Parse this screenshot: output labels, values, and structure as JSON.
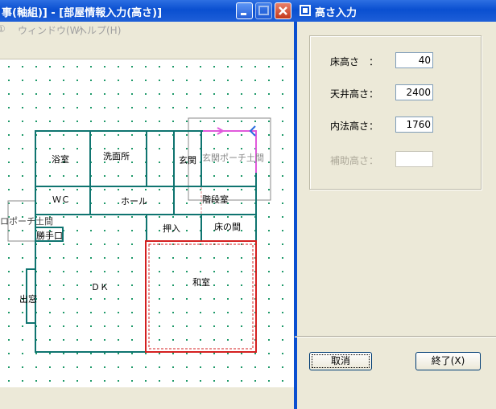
{
  "bg_window": {
    "title": "事(軸組)] - [部屋情報入力(高さ)]",
    "menu": [
      "①",
      "ウィンドウ(W)",
      "ヘルプ(H)"
    ]
  },
  "floor_plan": {
    "rooms": {
      "bath": "浴室",
      "washroom": "洗面所",
      "entrance": "玄関",
      "porch": "玄関ポーチ土間",
      "wc": "ＷＣ",
      "hall": "ホール",
      "stairs": "階段室",
      "back_porch": "ロポーチ土間",
      "back_door": "勝手口",
      "closet": "押入",
      "tokonoma": "床の間",
      "dk": "ＤＫ",
      "washitsu": "和室",
      "bay": "出窓"
    },
    "colors": {
      "wall": "#0f7470",
      "selected": "#d42020",
      "dot": "#1f9a6a"
    }
  },
  "dialog": {
    "title": "高さ入力",
    "fields": [
      {
        "label": "床高さ　：",
        "value": "40",
        "enabled": true
      },
      {
        "label": "天井高さ：",
        "value": "2400",
        "enabled": true
      },
      {
        "label": "内法高さ：",
        "value": "1760",
        "enabled": true
      },
      {
        "label": "補助高さ：",
        "value": "",
        "enabled": false
      }
    ],
    "cancel_label": "取消",
    "finish_label": "終了(X)"
  }
}
